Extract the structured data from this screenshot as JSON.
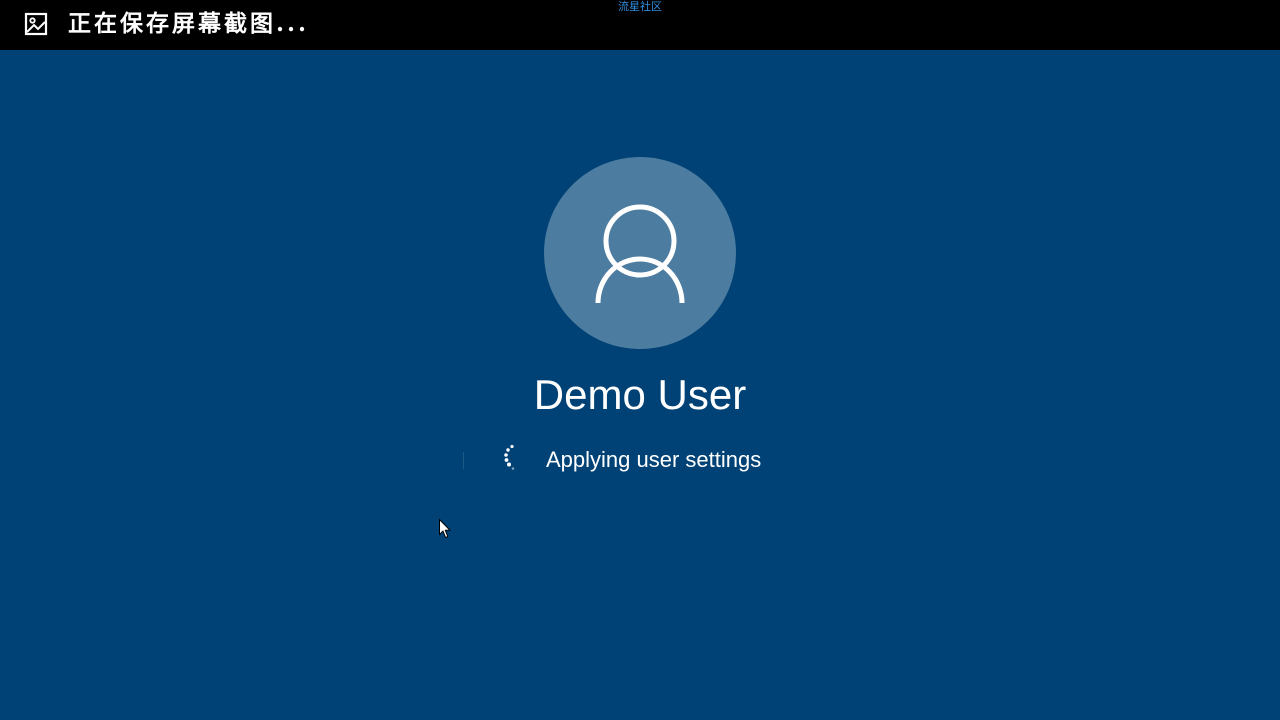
{
  "banner": {
    "icon": "screenshot-image-icon",
    "message": "正在保存屏幕截图..."
  },
  "watermark": "流星社区",
  "lock_screen": {
    "avatar_icon": "user-silhouette-icon",
    "user_name": "Demo User",
    "status_icon": "loading-spinner-icon",
    "status_text": "Applying user settings"
  },
  "colors": {
    "background": "#004275",
    "avatar_circle": "#4d7ca1",
    "banner": "#000000",
    "text": "#ffffff"
  }
}
